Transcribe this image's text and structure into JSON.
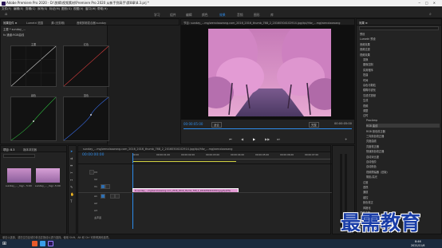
{
  "window": {
    "title": "Adobe Premiere Pro 2020 - D:\\剪辑\\视频素材\\Premiere Pro 2020 从新手到高手\\第8章\\8.3.prj *",
    "controls": [
      "─",
      "□",
      "✕"
    ]
  },
  "menu": [
    "文件(F)",
    "编辑(E)",
    "剪辑(C)",
    "序列(S)",
    "标记(M)",
    "图形(G)",
    "视图(V)",
    "窗口(W)",
    "帮助(H)"
  ],
  "workspaces": [
    "学习",
    "组件",
    "编辑",
    "颜色",
    "效果",
    "音频",
    "图形",
    "库"
  ],
  "workspace_active": "效果",
  "left_panel": {
    "tabs": [
      "效果控件 ≡",
      "Lumetri 范围",
      "源:(无剪辑)",
      "音频剪辑混合器:sunday"
    ],
    "clip_label": "主要 * sunday_...",
    "effect_row": "fx 通道:RGB曲线",
    "curves": [
      {
        "label": "主要"
      },
      {
        "label": "红色"
      },
      {
        "label": "绿色"
      },
      {
        "label": "蓝色"
      }
    ]
  },
  "program": {
    "header": "节目: sunday_...mg/wenxiaowang.com_2016_2016_thumb_768_2_20160504102914.jpg/dpi/hfw_...mg/wenxiaowang",
    "timecode_left": "00:00:05:00",
    "timecode_right": "00:00:05:00",
    "fit": "适合",
    "quality": "完整",
    "transport": [
      "⏮",
      "◀",
      "▶",
      "▶▶",
      "⏭",
      "+"
    ]
  },
  "project": {
    "tabs": [
      "项目: 8.3",
      "媒体浏览器"
    ],
    "search_placeholder": "",
    "items": [
      {
        "name": "sunday_..._mg/...",
        "duration": "5:00"
      },
      {
        "name": "sunday_..._mg/...",
        "duration": "5:00"
      }
    ]
  },
  "timeline": {
    "tab": "sunday_...mg/wenxiaowang.com_2016_2016_thumb_768_2_20160504102914.jpg/dpi/hfw_...mg/wenxiaowang",
    "timecode": "00:00:00:00",
    "ruler": [
      "00:00",
      "00:00:01:00",
      "00:00:02:00",
      "00:00:03:00",
      "00:00:04:00",
      "00:00:05:00",
      "00:00:06:00",
      "00:00:07:00"
    ],
    "tracks": [
      "V3",
      "V2",
      "V1",
      "A1",
      "A2",
      "A3"
    ],
    "clip_label": "fx sunday_...mg/wenxiaowang.com_2016_2016_thumb_768_2_20160504102914.jpg/dpi/hfw",
    "master": "主声道"
  },
  "effects_panel": {
    "title": "效果 ≡",
    "items": [
      "预设",
      "Lumetri 预设",
      "音频效果",
      "音频过渡",
      "视频效果",
      "变换",
      "图像控制",
      "实用程序",
      "扭曲",
      "时间",
      "杂色与颗粒",
      "模糊与锐化",
      "沉浸式视频",
      "生成",
      "视频",
      "调整",
      "过时",
      "ProcAmp",
      "RGB 曲线",
      "RGB 颜色校正器",
      "三向颜色校正器",
      "亮度曲线",
      "亮度校正器",
      "快速颜色校正器",
      "自动对比度",
      "自动色阶",
      "自动颜色",
      "视频限幅器（旧版）",
      "阴影/高光",
      "过渡",
      "透视",
      "通道",
      "键控",
      "颜色校正",
      "风格化",
      "视频过渡"
    ],
    "footer": "基本图形"
  },
  "status_text": "单击以选择，或在空白区域中单击并拖动以进行选择。使用 Shift、Alt 和 Ctrl 可获得其他选项。",
  "watermark": "最需教育",
  "taskbar": {
    "time": "8:46",
    "date": "2021/11/6"
  }
}
